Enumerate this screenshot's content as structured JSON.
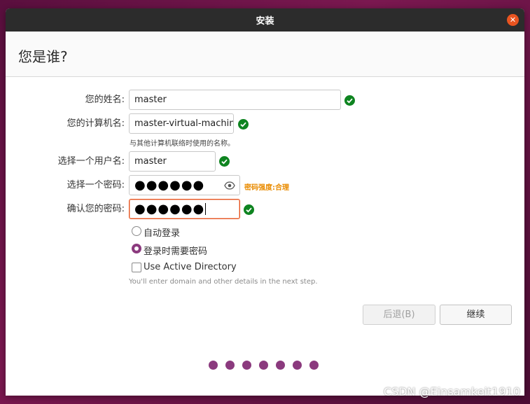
{
  "window": {
    "title": "安装",
    "close_symbol": "✕"
  },
  "page": {
    "heading": "您是谁?"
  },
  "form": {
    "name": {
      "label": "您的姓名:",
      "value": "master"
    },
    "computer_name": {
      "label": "您的计算机名:",
      "value": "master-virtual-machine",
      "hint": "与其他计算机联络时使用的名称。"
    },
    "username": {
      "label": "选择一个用户名:",
      "value": "master"
    },
    "password": {
      "label": "选择一个密码:",
      "value": "●●●●●●",
      "strength": "密码强度:合理"
    },
    "confirm_password": {
      "label": "确认您的密码:",
      "value": "●●●●●●"
    }
  },
  "options": {
    "auto_login": {
      "label": "自动登录",
      "checked": false
    },
    "require_password": {
      "label": "登录时需要密码",
      "checked": true
    },
    "active_directory": {
      "label": "Use Active Directory",
      "checked": false,
      "hint": "You'll enter domain and other details in the next step."
    }
  },
  "buttons": {
    "back": "后退(B)",
    "continue": "继续"
  },
  "progress": {
    "total_steps": 7
  },
  "colors": {
    "accent": "#e95420",
    "aubergine": "#8b3a7e",
    "success": "#0e8420",
    "strength_warning": "#e98b00"
  },
  "watermark": "CSDN @Einsamkeit1910"
}
